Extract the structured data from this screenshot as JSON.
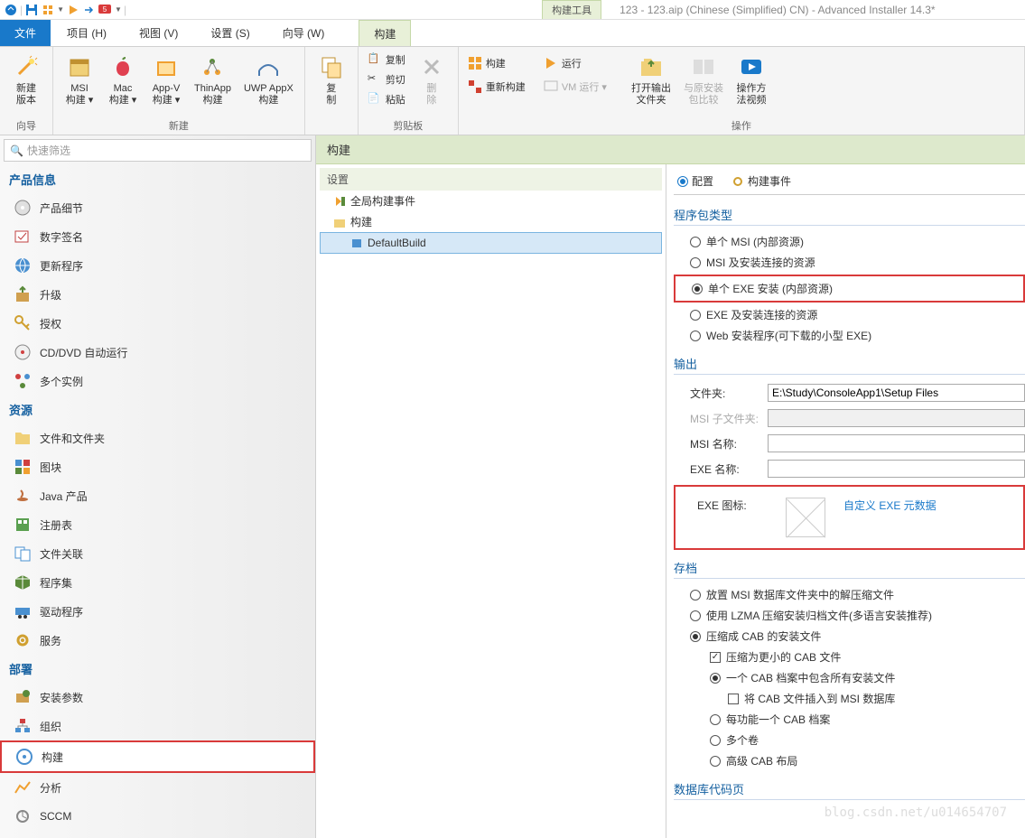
{
  "title": "123 - 123.aip (Chinese (Simplified) CN) - Advanced Installer 14.3*",
  "toolTab": "构建工具",
  "menu": {
    "file": "文件",
    "items": [
      "项目   (H)",
      "视图   (V)",
      "设置   (S)",
      "向导   (W)"
    ],
    "build": "构建"
  },
  "ribbon": {
    "g1": {
      "label": "向导",
      "btn": "新建\n版本"
    },
    "g2": {
      "label": "新建",
      "btns": [
        "MSI\n构建 ▾",
        "Mac\n构建 ▾",
        "App-V\n构建 ▾",
        "ThinApp\n构建",
        "UWP AppX\n构建"
      ]
    },
    "g3": {
      "label": "",
      "btn": "复\n制"
    },
    "g4": {
      "label": "剪贴板",
      "items": [
        "复制",
        "剪切",
        "粘贴"
      ],
      "del": "删\n除"
    },
    "g5": {
      "label": "操作",
      "build": "构建",
      "rebuild": "重新构建",
      "run": "运行",
      "vm": "VM 运行 ▾",
      "open": "打开输出\n文件夹",
      "compare": "与原安装\n包比较",
      "video": "操作方\n法视频"
    }
  },
  "searchPlaceholder": "快速筛选",
  "sidebar": {
    "s1": "产品信息",
    "s1items": [
      "产品细节",
      "数字签名",
      "更新程序",
      "升级",
      "授权",
      "CD/DVD 自动运行",
      "多个实例"
    ],
    "s2": "资源",
    "s2items": [
      "文件和文件夹",
      "图块",
      "Java 产品",
      "注册表",
      "文件关联",
      "程序集",
      "驱动程序",
      "服务"
    ],
    "s3": "部署",
    "s3items": [
      "安装参数",
      "组织",
      "构建",
      "分析",
      "SCCM"
    ]
  },
  "contentHeader": "构建",
  "treeSubheader": "设置",
  "tree": {
    "root": "全局构建事件",
    "folder": "构建",
    "item": "DefaultBuild"
  },
  "tabs": {
    "config": "配置",
    "events": "构建事件"
  },
  "packageType": {
    "title": "程序包类型",
    "o1": "单个 MSI (内部资源)",
    "o2": "MSI 及安装连接的资源",
    "o3": "单个 EXE 安装 (内部资源)",
    "o4": "EXE 及安装连接的资源",
    "o5": "Web 安装程序(可下载的小型 EXE)"
  },
  "output": {
    "title": "输出",
    "folderLabel": "文件夹:",
    "folderValue": "E:\\Study\\ConsoleApp1\\Setup Files",
    "msiSubLabel": "MSI 子文件夹:",
    "msiNameLabel": "MSI 名称:",
    "exeNameLabel": "EXE 名称:",
    "exeIconLabel": "EXE 图标:",
    "customLink": "自定义 EXE 元数据"
  },
  "archive": {
    "title": "存档",
    "a1": "放置 MSI 数据库文件夹中的解压缩文件",
    "a2": "使用 LZMA 压缩安装归档文件(多语言安装推荐)",
    "a3": "压缩成 CAB 的安装文件",
    "a3c1": "压缩为更小的 CAB 文件",
    "a3r1": "一个 CAB 档案中包含所有安装文件",
    "a3r1c": "将 CAB 文件插入到 MSI 数据库",
    "a3r2": "每功能一个 CAB 档案",
    "a3r3": "多个卷",
    "a3r4": "高级 CAB 布局"
  },
  "dbCodePage": "数据库代码页",
  "watermark": "blog.csdn.net/u014654707"
}
